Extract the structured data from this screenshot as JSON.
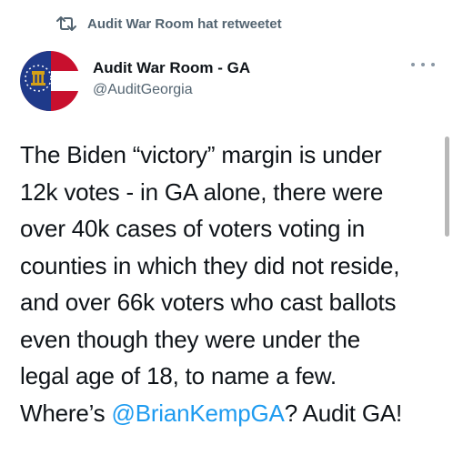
{
  "retweet": {
    "icon": "retweet-icon",
    "text": "Audit War Room hat retweetet"
  },
  "author": {
    "avatar": "georgia-flag-avatar",
    "name": "Audit War Room - GA",
    "handle": "@AuditGeorgia"
  },
  "tweet": {
    "line1": "The Biden “victory” margin is under",
    "line2": "12k votes - in GA alone, there were",
    "line3": "over 40k cases of voters voting in",
    "line4": "counties in which they did not reside,",
    "line5": "and over 66k voters who cast ballots",
    "line6": "even though they were under the",
    "line7": "legal age of 18, to name a few.",
    "line8_prefix": "Where’s ",
    "mention": "@BrianKempGA",
    "line8_suffix": "? Audit GA!"
  },
  "colors": {
    "mention": "#1d9bf0",
    "secondary_text": "#536471",
    "avatar_red": "#c8102e",
    "avatar_blue": "#1f3a8a",
    "avatar_gold": "#d4a017"
  }
}
